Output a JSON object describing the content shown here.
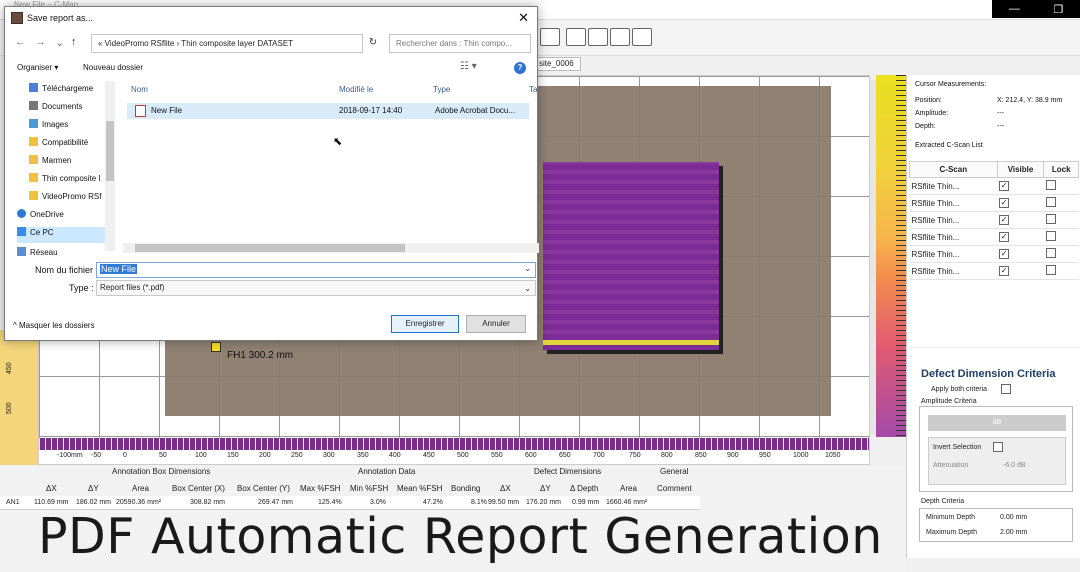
{
  "app": {
    "title": "New File – C-Map",
    "toolbar_icons": [
      "target-icon",
      "add-region-icon",
      "remove-region-icon",
      "monitor-icon",
      "print-icon"
    ],
    "tab_label": "site_0006",
    "annotation_label": "FH1 300.2 mm",
    "x_ticks": [
      "-100mm",
      "-50",
      "0",
      "50",
      "100",
      "150",
      "200",
      "250",
      "300",
      "350",
      "400",
      "450",
      "500",
      "550",
      "600",
      "650",
      "700",
      "750",
      "800",
      "850",
      "900",
      "950",
      "1000",
      "1050"
    ],
    "y_ticks": [
      "450",
      "500"
    ]
  },
  "right_panel": {
    "cursor_heading": "Cursor Measurements:",
    "position_label": "Position:",
    "position_value": "X: 212.4, Y: 38.9 mm",
    "amplitude_label": "Amplitude:",
    "amplitude_value": "---",
    "depth_label": "Depth:",
    "depth_value": "---",
    "list_heading": "Extracted C-Scan List",
    "table_headers": [
      "C-Scan",
      "Visible",
      "Lock"
    ],
    "rows": [
      "RSflite Thin...",
      "RSflite Thin...",
      "RSflite Thin...",
      "RSflite Thin...",
      "RSflite Thin...",
      "RSflite Thin..."
    ]
  },
  "criteria": {
    "title": "Defect Dimension Criteria",
    "apply_both": "Apply both criteria",
    "amplitude_heading": "Amplitude Criteria",
    "db_unit": "dB",
    "invert_selection": "Invert Selection",
    "attenuation_label": "Attenuation",
    "attenuation_value": "-6.0 dB",
    "depth_heading": "Depth Criteria",
    "min_depth_label": "Minimum Depth",
    "min_depth_value": "0.00 mm",
    "max_depth_label": "Maximum Depth",
    "max_depth_value": "2.00 mm"
  },
  "bottom_table": {
    "groups": [
      "Annotation Box Dimensions",
      "Annotation Data",
      "Defect Dimensions",
      "General"
    ],
    "columns": [
      "ΔX",
      "ΔY",
      "Area",
      "Box Center (X)",
      "Box Center (Y)",
      "Max %FSH",
      "Min %FSH",
      "Mean %FSH",
      "Bonding",
      "ΔX",
      "ΔY",
      "Δ Depth",
      "Area",
      "Comment"
    ],
    "row_id": "AN1",
    "row": [
      "110.69 mm",
      "186.02 mm",
      "20590.36 mm²",
      "308.82 mm",
      "269.47 mm",
      "125.4%",
      "3.0%",
      "47.2%",
      "8.1%",
      "99.50 mm",
      "176.20 mm",
      "0.99 mm",
      "1660.46 mm²",
      ""
    ]
  },
  "caption": "PDF Automatic Report Generation",
  "dialog": {
    "title": "Save report as...",
    "path": "« VideoPromo RSflite › Thin composite layer DATASET",
    "search_placeholder": "Rechercher dans : Thin compo...",
    "organize": "Organiser ▾",
    "new_folder": "Nouveau dossier",
    "nav_items": [
      "Téléchargeme",
      "Documents",
      "Images",
      "Compatibilité",
      "Marmen",
      "Thin composite l",
      "VideoPromo RSf",
      "OneDrive",
      "Ce PC",
      "Réseau"
    ],
    "file_headers": [
      "Nom",
      "Modifié le",
      "Type",
      "Ta"
    ],
    "file": {
      "name": "New File",
      "modified": "2018-09-17 14:40",
      "type": "Adobe Acrobat Docu..."
    },
    "filename_label": "Nom du fichier :",
    "filename_value": "New File",
    "type_label": "Type :",
    "type_value": "Report files (*.pdf)",
    "hide_folders": "Masquer les dossiers",
    "save_button": "Enregistrer",
    "cancel_button": "Annuler"
  }
}
